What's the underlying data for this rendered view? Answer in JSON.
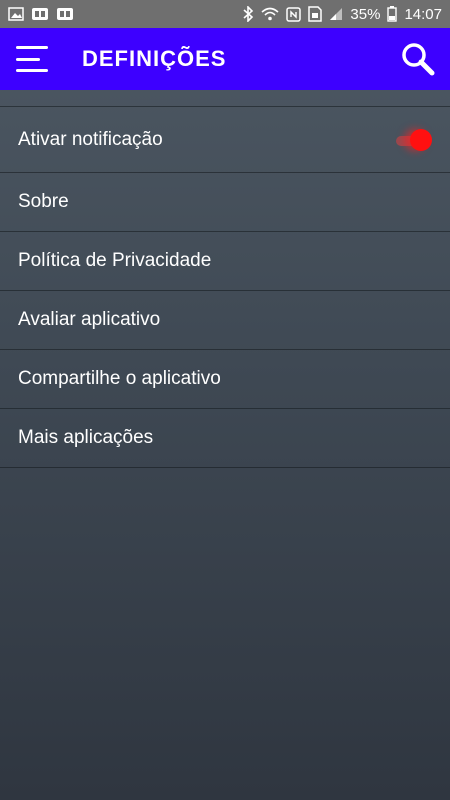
{
  "status_bar": {
    "battery_percent": "35%",
    "time": "14:07",
    "left_icons": [
      "image-icon",
      "pay-icon",
      "pay-icon"
    ],
    "right_icons": [
      "bluetooth-icon",
      "wifi-icon",
      "nfc-icon",
      "sim-icon",
      "signal-icon",
      "battery-icon"
    ]
  },
  "app_bar": {
    "title": "DEFINIÇÕES",
    "menu_icon": "hamburger-menu-icon",
    "search_icon": "search-icon",
    "color": "#3d00ff"
  },
  "settings": {
    "items": [
      {
        "label": "Ativar notificação",
        "toggle": true,
        "toggle_on": true
      },
      {
        "label": "Sobre"
      },
      {
        "label": "Política de Privacidade"
      },
      {
        "label": "Avaliar aplicativo"
      },
      {
        "label": "Compartilhe o aplicativo"
      },
      {
        "label": "Mais aplicações"
      }
    ]
  },
  "colors": {
    "toggle_on": "#ff1010",
    "background_top": "#4e5964",
    "background_bottom": "#2f3640"
  }
}
